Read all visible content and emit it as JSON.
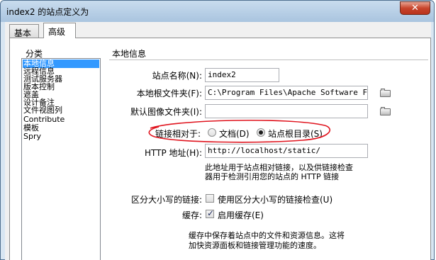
{
  "window": {
    "title": "index2 的站点定义为",
    "close_glyph": "✕"
  },
  "tabs": [
    {
      "label": "基本"
    },
    {
      "label": "高级"
    }
  ],
  "category": {
    "label": "分类",
    "items": [
      "本地信息",
      "远程信息",
      "测试服务器",
      "遮盖",
      "设计备注",
      "文件视图列",
      "Contribute",
      "模板",
      "Spry"
    ],
    "items_extra": {
      "version_control": "版本控制"
    },
    "selected": "本地信息"
  },
  "section": {
    "title": "本地信息"
  },
  "form": {
    "site_name": {
      "label": "站点名称(N):",
      "value": "index2"
    },
    "local_root": {
      "label": "本地根文件夹(F):",
      "value": "C:\\Program Files\\Apache Software Found"
    },
    "default_images": {
      "label": "默认图像文件夹(I):",
      "value": ""
    },
    "links_relative": {
      "label": "链接相对于:",
      "option_doc": "文档(D)",
      "option_site": "站点根目录(S)",
      "selected": "站点根目录(S)"
    },
    "http_address": {
      "label": "HTTP 地址(H):",
      "value": "http://localhost/static/"
    },
    "http_note": [
      "此地址用于站点相对链接，以及供链接检查",
      "器用于检测引用您的站点的 HTTP 链接"
    ],
    "case_sensitive": {
      "label": "区分大小写的链接:",
      "checkbox_label": "使用区分大小写的链接检查(U)",
      "checked": false
    },
    "cache": {
      "label": "缓存:",
      "checkbox_label": "启用缓存(E)",
      "checked": true
    },
    "cache_note": [
      "缓存中保存着站点中的文件和资源信息。这将",
      "加快资源面板和链接管理功能的速度。"
    ]
  },
  "colors": {
    "annotation": "#e0141e",
    "selection": "#3399ff"
  },
  "icons": {
    "folder": "folder-icon",
    "check": "✓"
  }
}
